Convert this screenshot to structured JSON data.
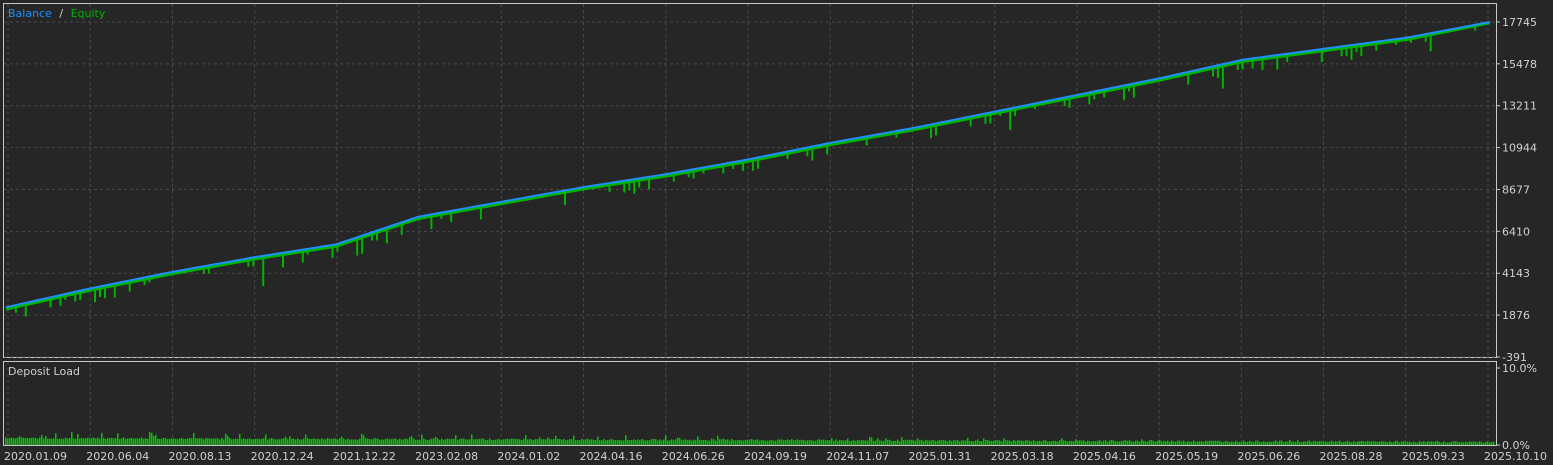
{
  "legend": {
    "balance_label": "Balance",
    "separator": "/",
    "equity_label": "Equity"
  },
  "colors": {
    "background": "#262626",
    "panel_border": "#c8c8c8",
    "grid": "#4a4a4a",
    "balance_line": "#1e90ff",
    "equity_line": "#00b400",
    "deposit_bars": "#00c800",
    "text": "#d0d0d0"
  },
  "chart_data": [
    {
      "type": "line",
      "title": "",
      "series": [
        {
          "name": "Balance",
          "x": [
            "2020.01.09",
            "2020.06.04",
            "2020.08.13",
            "2020.12.24",
            "2021.12.22",
            "2023.02.08",
            "2024.01.02",
            "2024.04.16",
            "2024.06.26",
            "2024.09.19",
            "2024.11.07",
            "2025.01.31",
            "2025.03.18",
            "2025.04.16",
            "2025.05.19",
            "2025.06.26",
            "2025.08.28",
            "2025.09.23",
            "2025.10.10"
          ],
          "values": [
            2300,
            3300,
            4200,
            5000,
            5700,
            7200,
            8000,
            8800,
            9500,
            10300,
            11200,
            12000,
            12900,
            13800,
            14700,
            15700,
            16300,
            16900,
            17745
          ]
        },
        {
          "name": "Equity",
          "x": [
            "2020.01.09",
            "2020.06.04",
            "2020.08.13",
            "2020.12.24",
            "2021.12.22",
            "2023.02.08",
            "2024.01.02",
            "2024.04.16",
            "2024.06.26",
            "2024.09.19",
            "2024.11.07",
            "2025.01.31",
            "2025.03.18",
            "2025.04.16",
            "2025.05.19",
            "2025.06.26",
            "2025.08.28",
            "2025.09.23",
            "2025.10.10"
          ],
          "values": [
            2200,
            3200,
            4100,
            4900,
            5600,
            7100,
            7900,
            8700,
            9400,
            10200,
            11100,
            11900,
            12800,
            13700,
            14600,
            15600,
            16200,
            16800,
            17700
          ]
        }
      ],
      "y_ticks": [
        "17745",
        "15478",
        "13211",
        "10944",
        "8677",
        "6410",
        "4143",
        "1876",
        "-391"
      ],
      "ylim": [
        -391,
        18500
      ],
      "grid": true,
      "legend_position": "top-left"
    },
    {
      "type": "bar",
      "title": "Deposit Load",
      "y_ticks": [
        "10.0%",
        "0.0%"
      ],
      "ylim": [
        0,
        10
      ],
      "typical_value_percent": 0.5,
      "grid": true
    }
  ],
  "x_ticks": [
    "2020.01.09",
    "2020.06.04",
    "2020.08.13",
    "2020.12.24",
    "2021.12.22",
    "2023.02.08",
    "2024.01.02",
    "2024.04.16",
    "2024.06.26",
    "2024.09.19",
    "2024.11.07",
    "2025.01.31",
    "2025.03.18",
    "2025.04.16",
    "2025.05.19",
    "2025.06.26",
    "2025.08.28",
    "2025.09.23",
    "2025.10.10"
  ]
}
